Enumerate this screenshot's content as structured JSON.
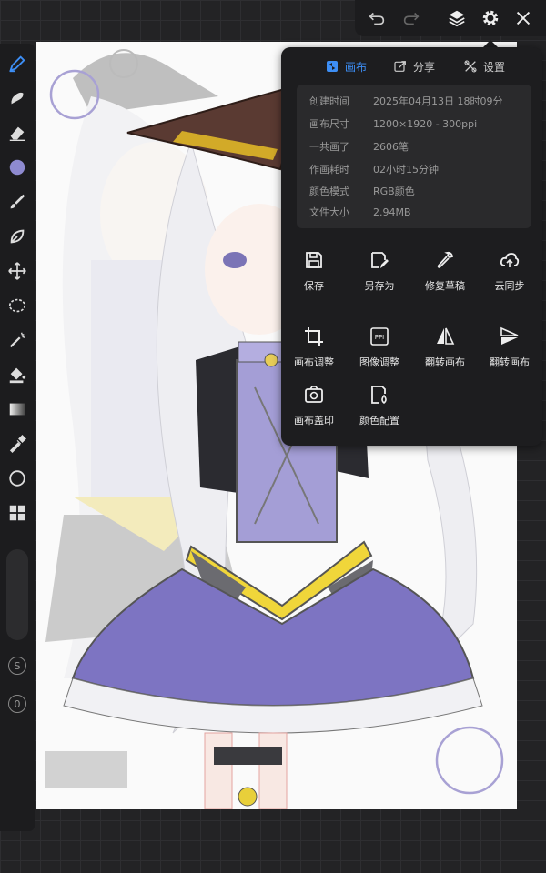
{
  "tabs": [
    {
      "label": "画布",
      "icon": "canvas-icon",
      "active": true
    },
    {
      "label": "分享",
      "icon": "share-icon",
      "active": false
    },
    {
      "label": "设置",
      "icon": "wrench-settings-icon",
      "active": false
    }
  ],
  "info": [
    {
      "label": "创建时间",
      "value": "2025年04月13日 18时09分"
    },
    {
      "label": "画布尺寸",
      "value": "1200×1920 - 300ppi"
    },
    {
      "label": "一共画了",
      "value": "2606笔"
    },
    {
      "label": "作画耗时",
      "value": "02小时15分钟"
    },
    {
      "label": "颜色模式",
      "value": "RGB颜色"
    },
    {
      "label": "文件大小",
      "value": "2.94MB"
    }
  ],
  "actions": [
    {
      "label": "保存",
      "icon": "save-icon"
    },
    {
      "label": "另存为",
      "icon": "save-as-icon"
    },
    {
      "label": "修复草稿",
      "icon": "repair-wrench-icon"
    },
    {
      "label": "云同步",
      "icon": "cloud-sync-icon"
    },
    {
      "label": "画布调整",
      "icon": "crop-icon"
    },
    {
      "label": "图像调整",
      "icon": "ppi-icon"
    },
    {
      "label": "翻转画布",
      "icon": "flip-horizontal-icon"
    },
    {
      "label": "翻转画布",
      "icon": "flip-vertical-icon"
    },
    {
      "label": "画布盖印",
      "icon": "canvas-stamp-icon"
    },
    {
      "label": "颜色配置",
      "icon": "color-config-icon"
    }
  ],
  "slider_values": {
    "size": "S",
    "opacity": "0"
  },
  "ppi_badge": "PPI",
  "colors": {
    "accent": "#3d8ef5",
    "brush_color": "#8e8ad0",
    "panel": "#1d1d1f"
  }
}
